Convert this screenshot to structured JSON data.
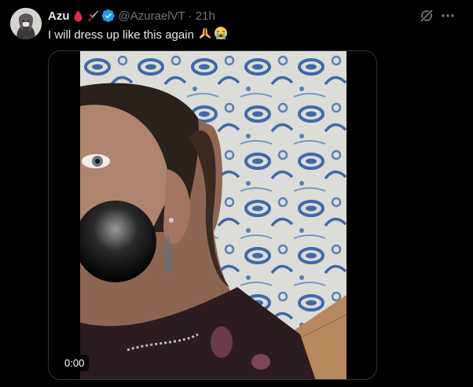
{
  "tweet": {
    "display_name": "Azu",
    "name_emojis": [
      "blood-drop-icon",
      "dagger-icon"
    ],
    "handle": "@AzuraelVT",
    "separator": "·",
    "time": "21h",
    "text": "I will dress up like this again",
    "text_emojis": [
      "folded-hands-icon",
      "crying-face-icon"
    ]
  },
  "video": {
    "timestamp": "0:00"
  },
  "colors": {
    "background": "#000000",
    "text_primary": "#e7e9ea",
    "text_secondary": "#71767b",
    "verified_blue": "#1d9bf0",
    "border": "#2f3336"
  }
}
